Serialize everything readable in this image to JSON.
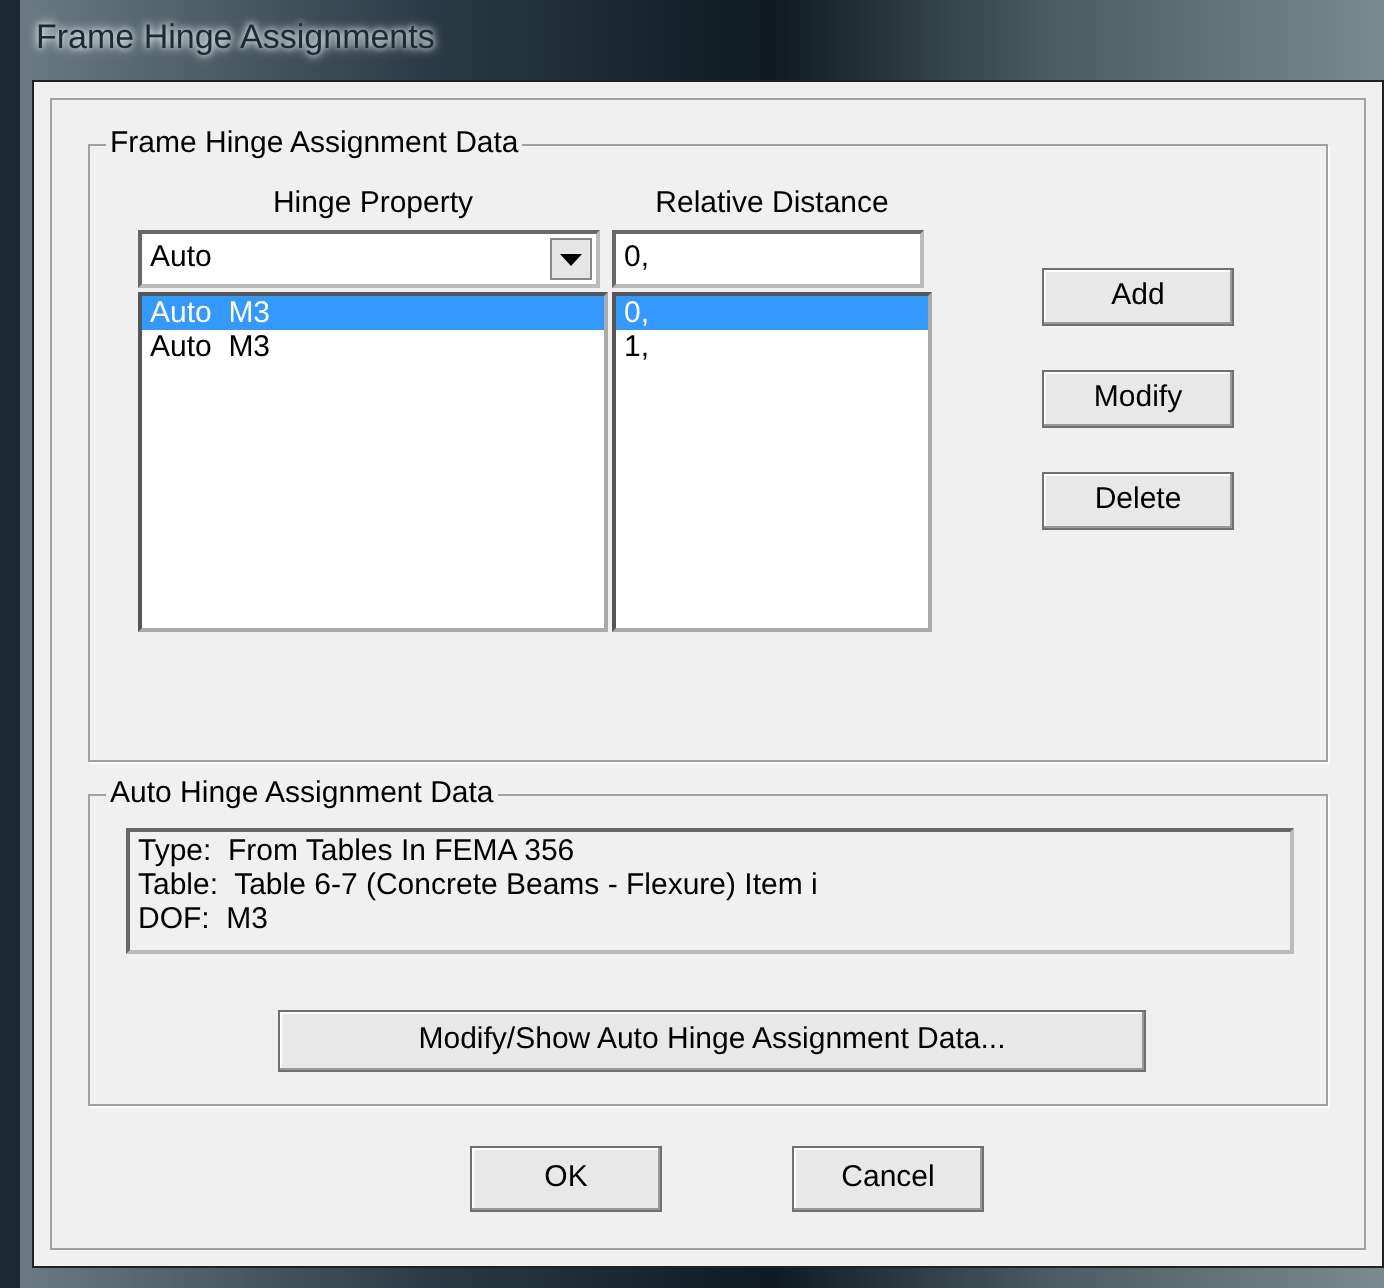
{
  "window": {
    "title": "Frame Hinge Assignments"
  },
  "assignment_group": {
    "title": "Frame Hinge Assignment Data",
    "columns": [
      "Hinge Property",
      "Relative Distance"
    ],
    "property_combo": {
      "value": "Auto"
    },
    "distance_field": {
      "value": "0,"
    },
    "hinges": [
      {
        "property": "Auto  M3",
        "distance": "0,",
        "selected": true
      },
      {
        "property": "Auto  M3",
        "distance": "1,",
        "selected": false
      }
    ],
    "buttons": [
      "Add",
      "Modify",
      "Delete"
    ]
  },
  "auto_group": {
    "title": "Auto Hinge Assignment Data",
    "lines": [
      "Type:  From Tables In FEMA 356",
      "Table:  Table 6-7 (Concrete Beams - Flexure) Item i",
      "DOF:  M3"
    ],
    "button": "Modify/Show Auto Hinge Assignment Data..."
  },
  "footer_buttons": [
    "OK",
    "Cancel"
  ]
}
